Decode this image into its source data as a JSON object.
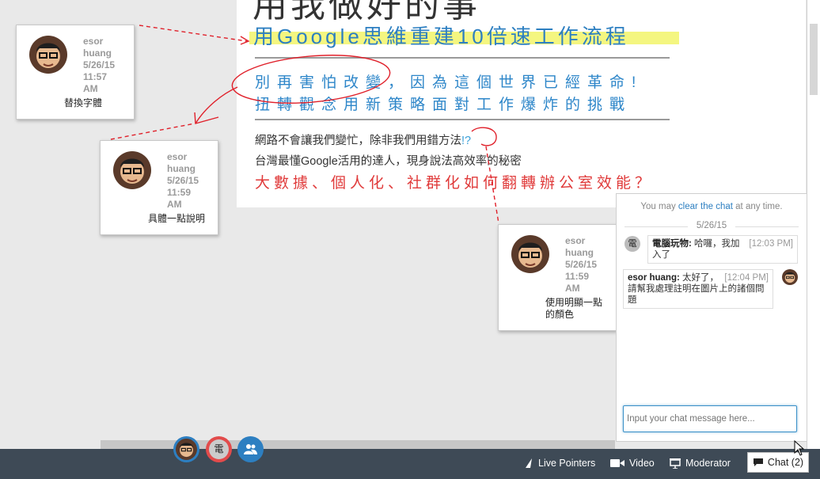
{
  "slide": {
    "title_top": "用我做好的事",
    "title_main": "用Google思維重建10倍速工作流程",
    "subtitle_line1": "別再害怕改變，因為這個世界已經革命!",
    "subtitle_line2": "扭轉觀念用新策略面對工作爆炸的挑戰",
    "text_line1_a": "網路不會讓我們變忙",
    "text_line1_b": "，除非我們用錯方法",
    "text_line1_c": "!?",
    "text_line2_a": "台灣最懂Google活用的達人",
    "text_line2_b": "，現身說法高效率的秘密",
    "red_line": "大數據、個人化、社群化如何翻轉辦公室效能？"
  },
  "notes": [
    {
      "author_line1": "esor",
      "author_line2": "huang",
      "date": "5/26/15",
      "time_line1": "11:57",
      "time_line2": "AM",
      "text": "替換字體"
    },
    {
      "author_line1": "esor",
      "author_line2": "huang",
      "date": "5/26/15",
      "time_line1": "11:59",
      "time_line2": "AM",
      "text": "具體一點說明"
    },
    {
      "author_line1": "esor",
      "author_line2": "huang",
      "date": "5/26/15",
      "time_line1": "11:59",
      "time_line2": "AM",
      "text": "使用明顯一點的顏色"
    }
  ],
  "chat": {
    "hint_before": "You may ",
    "hint_link": "clear the chat",
    "hint_after": " at any time.",
    "date": "5/26/15",
    "messages": [
      {
        "avatar_char": "電",
        "author": "電腦玩物:",
        "text": " 哈囉，我加入了",
        "time": "[12:03 PM]"
      },
      {
        "author": "esor huang:",
        "text": " 太好了，請幫我處理註明在圖片上的諸個問題",
        "time": "[12:04 PM]"
      }
    ],
    "input_placeholder": "Input your chat message here..."
  },
  "toolbar": {
    "live_pointers": "Live Pointers",
    "video": "Video",
    "moderator": "Moderator",
    "chat": "Chat (2)",
    "user2_char": "電"
  },
  "colors": {
    "accent": "#2d7fc1",
    "toolbar": "#3e4a56",
    "annotation_red": "#e0202a",
    "highlight": "#f2f56a"
  }
}
